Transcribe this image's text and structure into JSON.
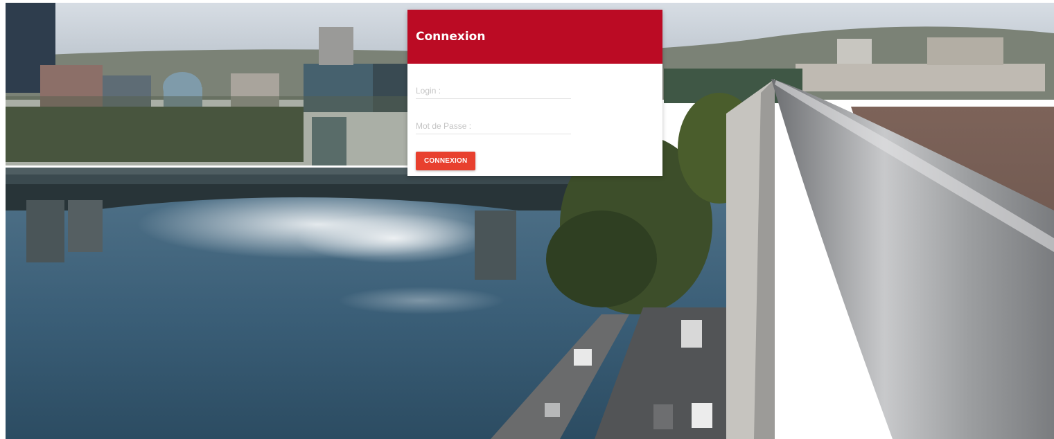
{
  "background": {
    "description_icon": "landscape-photo-icon"
  },
  "login": {
    "title": "Connexion",
    "login_placeholder": "Login :",
    "password_placeholder": "Mot de Passe :",
    "submit_label": "CONNEXION",
    "colors": {
      "header": "#bb0b24",
      "button": "#e8402e"
    }
  }
}
